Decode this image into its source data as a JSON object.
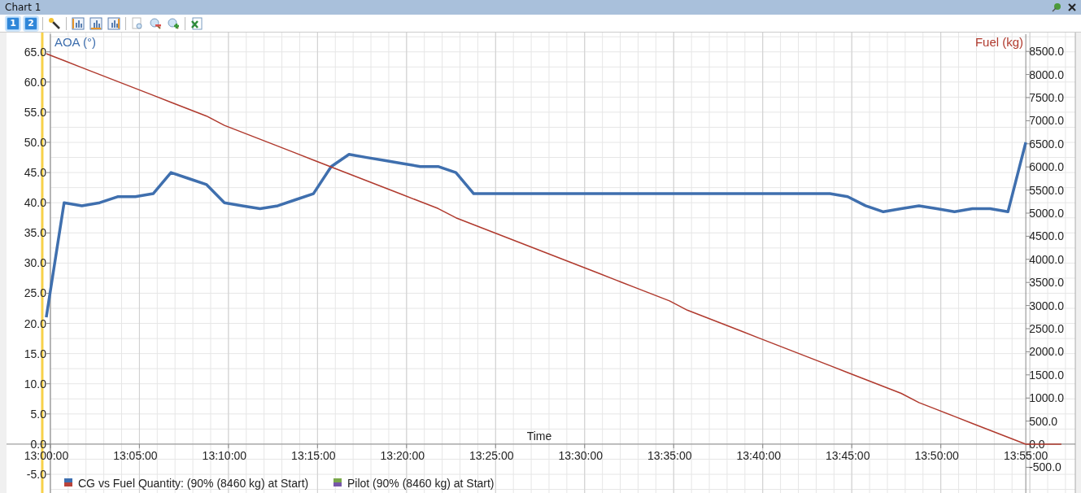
{
  "window": {
    "title": "Chart 1"
  },
  "toolbar": {
    "pages": [
      {
        "label": "1",
        "selected": true
      },
      {
        "label": "2",
        "selected": true
      }
    ]
  },
  "chart": {
    "chart_data": {
      "type": "line",
      "xlabel": "Time",
      "categories": [
        "13:00:00",
        null,
        null,
        null,
        null,
        "13:05:00",
        null,
        null,
        null,
        null,
        "13:10:00",
        null,
        null,
        null,
        null,
        "13:15:00",
        null,
        null,
        null,
        null,
        "13:20:00",
        null,
        null,
        null,
        null,
        "13:25:00",
        null,
        null,
        null,
        null,
        "13:30:00",
        null,
        null,
        null,
        null,
        "13:35:00",
        null,
        null,
        null,
        null,
        "13:40:00",
        null,
        null,
        null,
        null,
        "13:45:00",
        null,
        null,
        null,
        null,
        "13:50:00",
        null,
        null,
        null,
        null,
        "13:55:00",
        null,
        null
      ],
      "series": [
        {
          "name": "AOA (°)",
          "color": "#3f6fae",
          "values": [
            21,
            40,
            39.5,
            40,
            41,
            41,
            41.5,
            45,
            44,
            43,
            40,
            39.5,
            39,
            39.5,
            40.5,
            41.5,
            46,
            48,
            47.5,
            47,
            46.5,
            46,
            46,
            45,
            41.5,
            41.5,
            41.5,
            41.5,
            41.5,
            41.5,
            41.5,
            41.5,
            41.5,
            41.5,
            41.5,
            41.5,
            41.5,
            41.5,
            41.5,
            41.5,
            41.5,
            41.5,
            41.5,
            41.5,
            41.5,
            41,
            39.5,
            38.5,
            39,
            39.5,
            39,
            38.5,
            39,
            39,
            38.5,
            50,
            null,
            null
          ]
        },
        {
          "name": "Fuel (kg)",
          "color": "#b03a2e",
          "axis": "y2",
          "values": [
            8450,
            8300,
            8150,
            8000,
            7850,
            7700,
            7550,
            7400,
            7250,
            7100,
            6900,
            6750,
            6600,
            6450,
            6300,
            6150,
            6000,
            5850,
            5700,
            5550,
            5400,
            5250,
            5100,
            4900,
            4750,
            4600,
            4450,
            4300,
            4150,
            4000,
            3850,
            3700,
            3550,
            3400,
            3250,
            3100,
            2900,
            2750,
            2600,
            2450,
            2300,
            2150,
            2000,
            1850,
            1700,
            1550,
            1400,
            1250,
            1100,
            900,
            750,
            600,
            450,
            300,
            150,
            0,
            0,
            0
          ]
        }
      ],
      "grid": true,
      "ylim": [
        -8.1,
        68.2
      ],
      "y2lim": [
        -1056,
        8908
      ],
      "yticks": [
        {
          "value": -5,
          "label": "-5.0"
        },
        {
          "value": 0,
          "label": "0.0"
        },
        {
          "value": 5,
          "label": "5.0"
        },
        {
          "value": 10,
          "label": "10.0"
        },
        {
          "value": 15,
          "label": "15.0"
        },
        {
          "value": 20,
          "label": "20.0"
        },
        {
          "value": 25,
          "label": "25.0"
        },
        {
          "value": 30,
          "label": "30.0"
        },
        {
          "value": 35,
          "label": "35.0"
        },
        {
          "value": 40,
          "label": "40.0"
        },
        {
          "value": 45,
          "label": "45.0"
        },
        {
          "value": 50,
          "label": "50.0"
        },
        {
          "value": 55,
          "label": "55.0"
        },
        {
          "value": 60,
          "label": "60.0"
        },
        {
          "value": 65,
          "label": "65.0"
        }
      ],
      "y2ticks": [
        {
          "value": -500,
          "label": "-500.0"
        },
        {
          "value": 0,
          "label": "0.0"
        },
        {
          "value": 500,
          "label": "500.0"
        },
        {
          "value": 1000,
          "label": "1000.0"
        },
        {
          "value": 1500,
          "label": "1500.0"
        },
        {
          "value": 2000,
          "label": "2000.0"
        },
        {
          "value": 2500,
          "label": "2500.0"
        },
        {
          "value": 3000,
          "label": "3000.0"
        },
        {
          "value": 3500,
          "label": "3500.0"
        },
        {
          "value": 4000,
          "label": "4000.0"
        },
        {
          "value": 4500,
          "label": "4500.0"
        },
        {
          "value": 5000,
          "label": "5000.0"
        },
        {
          "value": 5500,
          "label": "5500.0"
        },
        {
          "value": 6000,
          "label": "6000.0"
        },
        {
          "value": 6500,
          "label": "6500.0"
        },
        {
          "value": 7000,
          "label": "7000.0"
        },
        {
          "value": 7500,
          "label": "7500.0"
        },
        {
          "value": 8000,
          "label": "8000.0"
        },
        {
          "value": 8500,
          "label": "8500.0"
        }
      ]
    },
    "legend": [
      {
        "label": "CG vs Fuel Quantity:  (90% (8460 kg) at Start)",
        "color": "#3d6fb0"
      },
      {
        "label": "Pilot (90% (8460 kg) at Start)",
        "color": "#7aa84a"
      }
    ]
  }
}
